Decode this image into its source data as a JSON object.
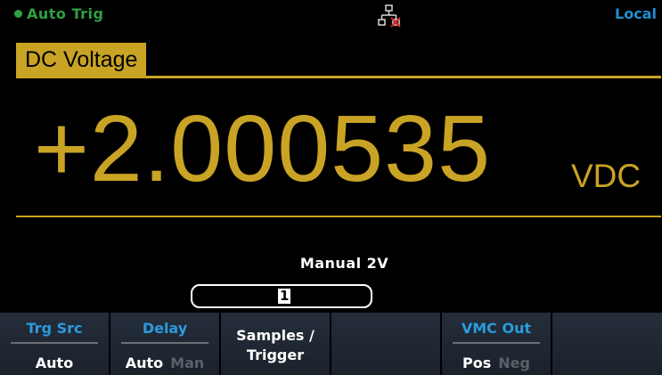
{
  "status_bar": {
    "trigger": "Auto Trig",
    "mode": "Local",
    "icons": {
      "network": "network-disconnected-icon"
    },
    "colors": {
      "trigger": "#2ea043",
      "mode": "#1f8fd4"
    }
  },
  "measurement": {
    "function": "DC Voltage",
    "value": "+2.000535",
    "unit": "VDC",
    "color": "#c9a324"
  },
  "range": {
    "label": "Manual  2V",
    "samples_value": "1"
  },
  "softkeys": [
    {
      "top": "Trg  Src",
      "bottom": "Auto"
    },
    {
      "top": "Delay",
      "options": [
        "Auto",
        "Man"
      ],
      "selected": "Auto"
    },
    {
      "line1": "Samples /",
      "line2": "Trigger"
    },
    {
      "top": "",
      "bottom": ""
    },
    {
      "top": "VMC  Out",
      "options": [
        "Pos",
        "Neg"
      ],
      "selected": "Pos"
    },
    {
      "top": "",
      "bottom": ""
    }
  ]
}
